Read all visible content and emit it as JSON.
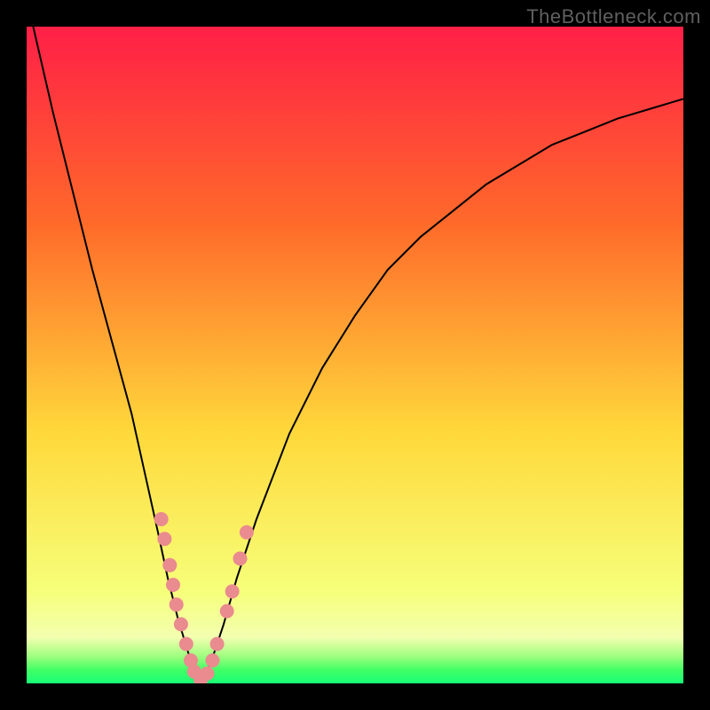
{
  "watermark": "TheBottleneck.com",
  "gradient": {
    "top": "#ff1f47",
    "mid1": "#ff6a2a",
    "mid2": "#ffd93b",
    "mid3": "#f6ff7a",
    "bottom_band": "#f3ffb0",
    "green1": "#9aff7d",
    "green2": "#3fff66",
    "green3": "#19ff76"
  },
  "curve": {
    "stroke": "#000000",
    "stroke_width": 2
  },
  "markers": {
    "color": "#e98b8f",
    "radius": 8
  },
  "chart_data": {
    "type": "line",
    "title": "",
    "xlabel": "",
    "ylabel": "",
    "xlim": [
      0,
      100
    ],
    "ylim": [
      0,
      100
    ],
    "series": [
      {
        "name": "bottleneck-curve",
        "x": [
          1,
          4,
          7,
          10,
          13,
          16,
          18,
          20,
          21.5,
          23,
          24.5,
          25.5,
          26.5,
          28,
          30,
          32,
          35,
          40,
          45,
          50,
          55,
          60,
          65,
          70,
          75,
          80,
          85,
          90,
          95,
          100
        ],
        "y": [
          100,
          87,
          75,
          63,
          52,
          41,
          32,
          23,
          16,
          10,
          5,
          2,
          0,
          3,
          9,
          16,
          25,
          38,
          48,
          56,
          63,
          68,
          72,
          76,
          79,
          82,
          84,
          86,
          87.5,
          89
        ]
      }
    ],
    "markers": [
      {
        "x": 20.5,
        "y": 25
      },
      {
        "x": 21.0,
        "y": 22
      },
      {
        "x": 21.8,
        "y": 18
      },
      {
        "x": 22.3,
        "y": 15
      },
      {
        "x": 22.8,
        "y": 12
      },
      {
        "x": 23.5,
        "y": 9
      },
      {
        "x": 24.3,
        "y": 6
      },
      {
        "x": 25.0,
        "y": 3.5
      },
      {
        "x": 25.5,
        "y": 1.8
      },
      {
        "x": 26.5,
        "y": 0.5
      },
      {
        "x": 27.5,
        "y": 1.5
      },
      {
        "x": 28.3,
        "y": 3.5
      },
      {
        "x": 29.0,
        "y": 6
      },
      {
        "x": 30.5,
        "y": 11
      },
      {
        "x": 31.3,
        "y": 14
      },
      {
        "x": 32.5,
        "y": 19
      },
      {
        "x": 33.5,
        "y": 23
      }
    ]
  }
}
